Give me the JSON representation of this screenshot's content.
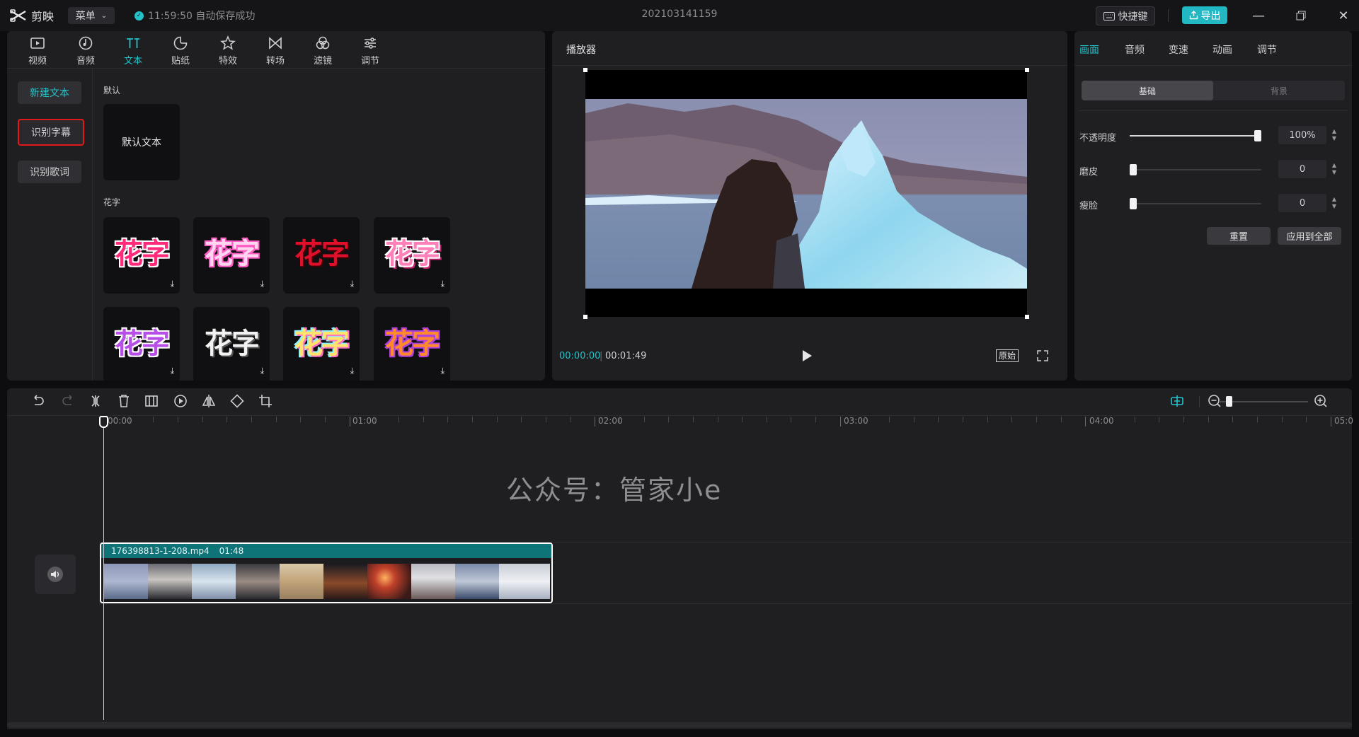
{
  "app": {
    "logo_text": "剪映",
    "menu_label": "菜单",
    "autosave_text": "11:59:50 自动保存成功",
    "project_title": "202103141159",
    "shortcut_label": "快捷键",
    "export_label": "导出"
  },
  "media_tabs": [
    {
      "label": "视频",
      "icon": "video-icon"
    },
    {
      "label": "音频",
      "icon": "audio-icon"
    },
    {
      "label": "文本",
      "icon": "text-icon",
      "active": true
    },
    {
      "label": "贴纸",
      "icon": "sticker-icon"
    },
    {
      "label": "特效",
      "icon": "effects-icon"
    },
    {
      "label": "转场",
      "icon": "transition-icon"
    },
    {
      "label": "滤镜",
      "icon": "filter-icon"
    },
    {
      "label": "调节",
      "icon": "adjust-icon"
    }
  ],
  "text_sidebar": {
    "new_text": "新建文本",
    "recognize_subtitles": "识别字幕",
    "recognize_lyrics": "识别歌词"
  },
  "text_library": {
    "default_section": "默认",
    "default_tile": "默认文本",
    "fancy_section": "花字",
    "fancy_text": "花字"
  },
  "player": {
    "title": "播放器",
    "current_time": "00:00:00",
    "total_time": "00:01:49",
    "ratio_label": "原始"
  },
  "properties": {
    "tabs": [
      "画面",
      "音频",
      "变速",
      "动画",
      "调节"
    ],
    "segments": [
      "基础",
      "背景"
    ],
    "opacity_label": "不透明度",
    "opacity_value": "100%",
    "opacity_level": 1.0,
    "smooth_label": "磨皮",
    "smooth_value": "0",
    "slim_label": "瘦脸",
    "slim_value": "0",
    "reset_label": "重置",
    "apply_all_label": "应用到全部"
  },
  "timeline": {
    "ruler_labels": [
      "00:00",
      "01:00",
      "02:00",
      "03:00",
      "04:00",
      "05:0"
    ],
    "watermark": "公众号：管家小e",
    "clip_name": "176398813-1-208.mp4",
    "clip_duration": "01:48"
  },
  "colors": {
    "accent": "#22c3c9",
    "export": "#22b8c3",
    "highlight_border": "#e01a1a",
    "clip_header": "#0f7478"
  }
}
